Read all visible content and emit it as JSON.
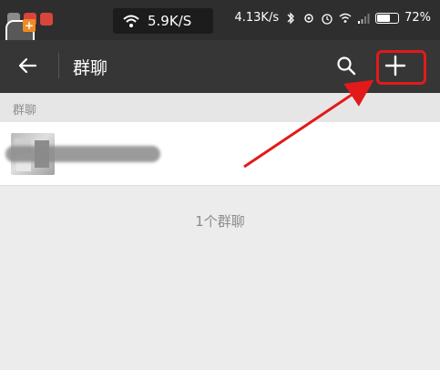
{
  "status_bar": {
    "net_speed_primary": "5.9K/S",
    "net_speed_secondary": "4.13K/s",
    "battery_percent": "72%",
    "battery_level": 0.72
  },
  "header": {
    "title": "群聊",
    "back_icon": "arrow-left-icon",
    "search_icon": "search-icon",
    "add_icon": "plus-icon"
  },
  "section": {
    "label": "群聊"
  },
  "groups": [
    {
      "name_redacted": true
    }
  ],
  "footer": {
    "count_text": "1个群聊"
  },
  "colors": {
    "status_bar_bg": "#2e2e2e",
    "title_bar_bg": "#363636",
    "annotation_red": "#e21a1a",
    "page_bg": "#ececec"
  }
}
